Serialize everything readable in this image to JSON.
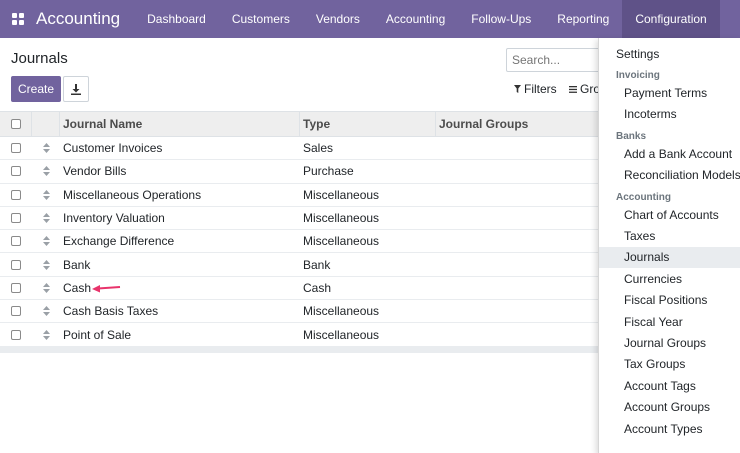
{
  "navbar": {
    "app_title": "Accounting",
    "menu": [
      "Dashboard",
      "Customers",
      "Vendors",
      "Accounting",
      "Follow-Ups",
      "Reporting",
      "Configuration"
    ],
    "active_menu": "Configuration"
  },
  "control_panel": {
    "title": "Journals",
    "create_label": "Create",
    "search_placeholder": "Search...",
    "filters_label": "Filters",
    "group_by_label": "Gro"
  },
  "table": {
    "columns": [
      "Journal Name",
      "Type",
      "Journal Groups"
    ],
    "rows": [
      {
        "name": "Customer Invoices",
        "type": "Sales"
      },
      {
        "name": "Vendor Bills",
        "type": "Purchase"
      },
      {
        "name": "Miscellaneous Operations",
        "type": "Miscellaneous"
      },
      {
        "name": "Inventory Valuation",
        "type": "Miscellaneous"
      },
      {
        "name": "Exchange Difference",
        "type": "Miscellaneous"
      },
      {
        "name": "Bank",
        "type": "Bank"
      },
      {
        "name": "Cash",
        "type": "Cash"
      },
      {
        "name": "Cash Basis Taxes",
        "type": "Miscellaneous"
      },
      {
        "name": "Point of Sale",
        "type": "Miscellaneous"
      }
    ]
  },
  "dropdown": {
    "settings": "Settings",
    "sections": [
      {
        "header": "Invoicing",
        "items": [
          "Payment Terms",
          "Incoterms"
        ]
      },
      {
        "header": "Banks",
        "items": [
          "Add a Bank Account",
          "Reconciliation Models"
        ]
      },
      {
        "header": "Accounting",
        "items": [
          "Chart of Accounts",
          "Taxes",
          "Journals",
          "Currencies",
          "Fiscal Positions",
          "Fiscal Year",
          "Journal Groups",
          "Tax Groups",
          "Account Tags",
          "Account Groups",
          "Account Types"
        ]
      }
    ],
    "active_item": "Journals"
  },
  "colors": {
    "brand": "#71639e",
    "arrow": "#e8336b"
  }
}
